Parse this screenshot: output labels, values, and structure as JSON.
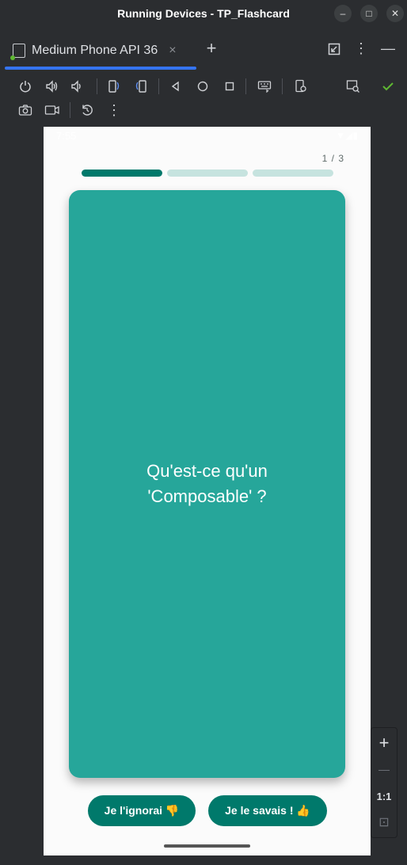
{
  "window": {
    "title": "Running Devices - TP_Flashcard",
    "controls": {
      "minimize": "–",
      "maximize": "□",
      "close": "✕"
    }
  },
  "tabs": [
    {
      "label": "Medium Phone API 36",
      "close": "×",
      "icon": "phone-device-icon"
    }
  ],
  "tabbar_actions": {
    "add": "+",
    "more": "⋮",
    "hide": "—"
  },
  "toolbar": {
    "row1": [
      "power-icon",
      "volume-up-icon",
      "volume-down-icon",
      "rotate-left-icon",
      "rotate-right-icon",
      "back-icon",
      "home-icon",
      "overview-icon",
      "keyboard-icon",
      "device-settings-icon",
      "screen-inspect-icon",
      "check-icon"
    ],
    "row2": [
      "camera-icon",
      "video-icon",
      "reset-icon",
      "more-icon"
    ]
  },
  "device": {
    "status_time": "7:55",
    "counter": "1 / 3",
    "progress": {
      "current": 1,
      "total": 3
    },
    "card": {
      "question": "Qu'est-ce qu'un 'Composable' ?"
    },
    "buttons": {
      "unknown": "Je l'ignorai 👎",
      "known": "Je le savais ! 👍"
    }
  },
  "zoom": {
    "in": "+",
    "out": "—",
    "actual": "1:1",
    "fit": "⊡"
  },
  "colors": {
    "accent": "#3574f0",
    "card": "#26a69a",
    "button": "#00796b",
    "progress_active": "#00796b",
    "progress_inactive": "#c6e3df"
  }
}
